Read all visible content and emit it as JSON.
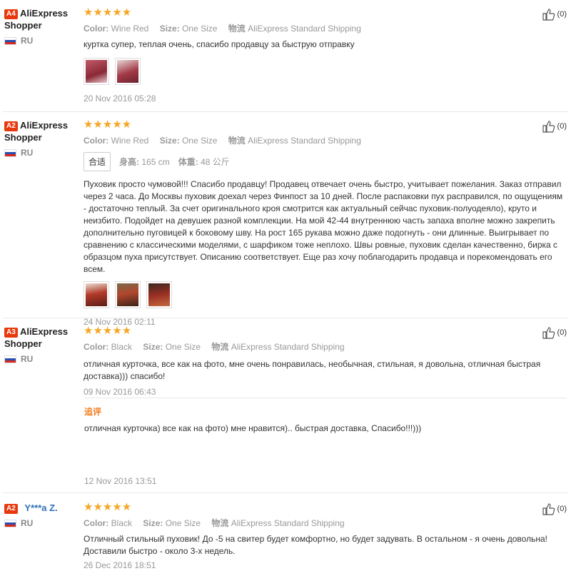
{
  "reviews": [
    {
      "level": "A4",
      "name": "AliExpress Shopper",
      "country": "RU",
      "stars": "★★★★★",
      "color_label": "Color:",
      "color": "Wine Red",
      "size_label": "Size:",
      "size": "One Size",
      "ship_label": "物流",
      "ship": "AliExpress Standard Shipping",
      "text": "куртка супер, теплая очень, спасибо продавцу за быструю отправку",
      "date": "20 Nov 2016 05:28",
      "likes": "(0)"
    },
    {
      "level": "A2",
      "name": "AliExpress Shopper",
      "country": "RU",
      "stars": "★★★★★",
      "color_label": "Color:",
      "color": "Wine Red",
      "size_label": "Size:",
      "size": "One Size",
      "ship_label": "物流",
      "ship": "AliExpress Standard Shipping",
      "fit_tag": "合适",
      "height_label": "身高:",
      "height": "165 cm",
      "weight_label": "体重:",
      "weight": "48 公斤",
      "text": "Пуховик просто чумовой!!! Спасибо продавцу! Продавец отвечает очень быстро, учитывает пожелания. Заказ отправил через 2 часа. До Москвы пуховик доехал через Финпост за 10 дней. После распаковки пух расправился, по ощущениям - достаточно теплый. За счет оригинального кроя смотрится как актуальный сейчас пуховик-полуодеяло), круто и неизбито. Подойдет на девушек разной комплекции. На мой 42-44 внутреннюю часть запаха вполне можно закрепить дополнительно пуговицей к боковому шву. На рост 165 рукава можно даже подогнуть - они длинные. Выигрывает по сравнению с классическими моделями, с шарфиком тоже неплохо. Швы ровные, пуховик сделан качественно, бирка с образцом пуха присутствует. Описанию соответствует. Еще раз хочу поблагодарить продавца и порекомендовать его всем.",
      "date": "24 Nov 2016 02:11",
      "likes": "(0)"
    },
    {
      "level": "A3",
      "name": "AliExpress Shopper",
      "country": "RU",
      "stars": "★★★★★",
      "color_label": "Color:",
      "color": "Black",
      "size_label": "Size:",
      "size": "One Size",
      "ship_label": "物流",
      "ship": "AliExpress Standard Shipping",
      "text": "отличная курточка, все как на фото, мне очень понравилась, необычная, стильная, я довольна, отличная быстрая доставка))) спасибо!",
      "date": "09 Nov 2016 06:43",
      "followup_label": "追评",
      "followup_text": "отличная курточка) все как на фото) мне нравится).. быстрая доставка, Спасибо!!!)))",
      "followup_date": "12 Nov 2016 13:51",
      "likes": "(0)"
    },
    {
      "level": "A2",
      "name": "Y***a Z.",
      "country": "RU",
      "stars": "★★★★★",
      "color_label": "Color:",
      "color": "Black",
      "size_label": "Size:",
      "size": "One Size",
      "ship_label": "物流",
      "ship": "AliExpress Standard Shipping",
      "text": "Отличный стильный пуховик! До -5 на свитер будет комфортно, но будет задувать. В остальном - я очень довольна! Доставили быстро - около 3-х недель.",
      "date": "26 Dec 2016 18:51",
      "likes": "(0)"
    }
  ],
  "icons": {
    "like": "thumbs-up-icon",
    "flag": "russia-flag-icon",
    "star": "star-icon"
  },
  "colors": {
    "stars": "#f5a623",
    "level_badge": "#e8390e",
    "followup": "#f27c1e",
    "name_link": "#2f6fb8"
  }
}
